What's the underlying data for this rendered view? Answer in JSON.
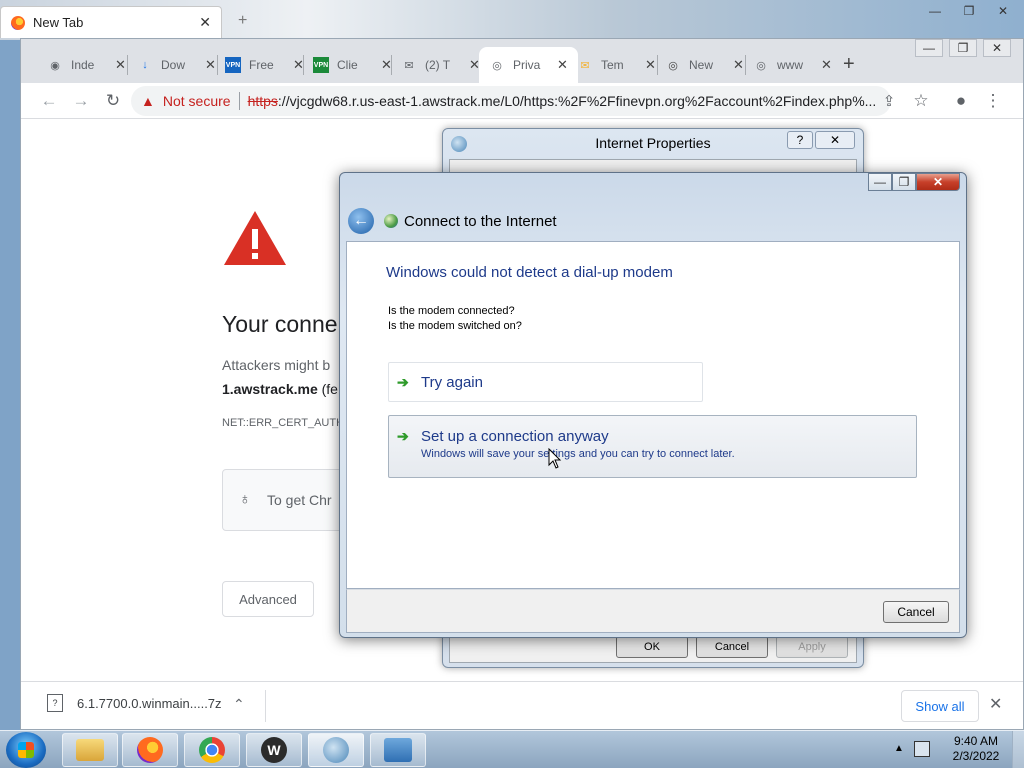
{
  "firefox": {
    "tab_label": "New Tab",
    "close_symbol": "✕",
    "new_tab_symbol": "+",
    "win_buttons": [
      "—",
      "❐",
      "✕"
    ]
  },
  "chrome": {
    "tabs": [
      {
        "label": "Inde",
        "icon": "github-icon",
        "glyph": "◉"
      },
      {
        "label": "Dow",
        "icon": "download-icon",
        "glyph": "↓"
      },
      {
        "label": "Free",
        "icon": "vpn-icon",
        "glyph": "VPN"
      },
      {
        "label": "Clie",
        "icon": "vpn-green-icon",
        "glyph": "VPN"
      },
      {
        "label": "(2) T",
        "icon": "mail-icon",
        "glyph": "✉"
      },
      {
        "label": "Priva",
        "icon": "globe-icon",
        "glyph": "◎"
      },
      {
        "label": "Tem",
        "icon": "mailbox-icon",
        "glyph": "✉"
      },
      {
        "label": "New",
        "icon": "chrome-icon",
        "glyph": "◎"
      },
      {
        "label": "www",
        "icon": "globe-icon",
        "glyph": "◎"
      }
    ],
    "tab_close": "✕",
    "new_tab": "+",
    "win_buttons": [
      "—",
      "❐",
      "✕"
    ],
    "toolbar": {
      "back": "←",
      "forward": "→",
      "reload": "↻",
      "not_secure": "Not secure",
      "url_scheme": "https",
      "url_rest": "://vjcgdw68.r.us-east-1.awstrack.me/L0/https:%2F%2Ffinevpn.org%2Faccount%2Findex.php%...",
      "share": "⇪",
      "star": "☆",
      "profile": "●",
      "menu": "⋮"
    },
    "page": {
      "title": "Your conne",
      "body": "Attackers might b",
      "host_bold": "1.awstrack.me",
      "host_rest": " (fe",
      "error_code": "NET::ERR_CERT_AUTHO",
      "tip": "To get Chr",
      "tip_icon": "💡",
      "advanced": "Advanced"
    },
    "download": {
      "filename": "6.1.7700.0.winmain.....7z",
      "chevron": "⌃",
      "show_all": "Show all",
      "close": "✕"
    }
  },
  "internet_properties": {
    "title": "Internet Properties",
    "help": "?",
    "close": "✕",
    "buttons": {
      "ok": "OK",
      "cancel": "Cancel",
      "apply": "Apply"
    }
  },
  "connect_dialog": {
    "title": "Connect to the Internet",
    "win_buttons": {
      "min": "—",
      "max": "❐",
      "close": "✕"
    },
    "back_symbol": "←",
    "heading": "Windows could not detect a dial-up modem",
    "question1": "Is the modem connected?",
    "question2": "Is the modem switched on?",
    "option_try_again": "Try again",
    "option_setup": "Set up a connection anyway",
    "option_setup_sub": "Windows will save your settings and you can try to connect later.",
    "arrow": "➔",
    "cancel": "Cancel"
  },
  "taskbar": {
    "clock_time": "9:40 AM",
    "clock_date": "2/3/2022",
    "tray_arrow": "▲"
  }
}
